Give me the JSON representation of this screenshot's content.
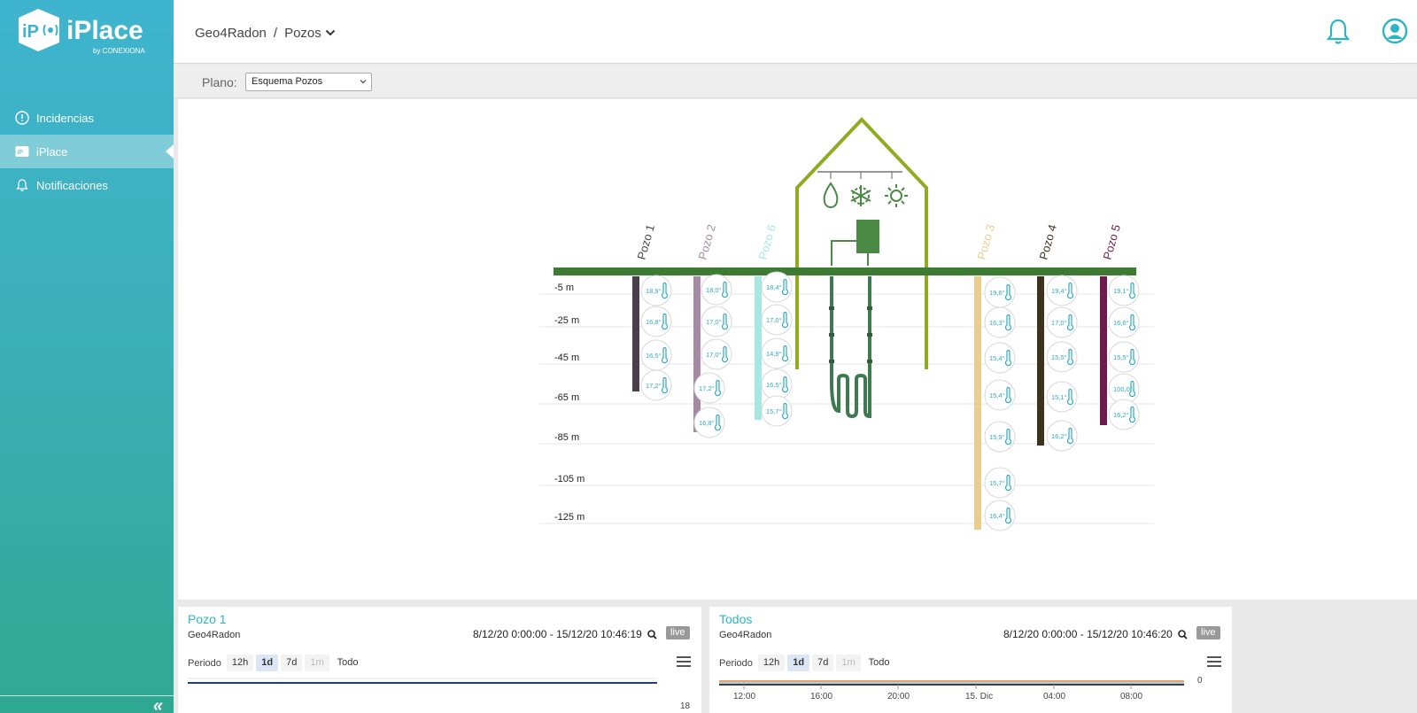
{
  "app": {
    "logo_text": "iPlace",
    "logo_byline": "by CONEXIONA"
  },
  "sidebar": {
    "items": [
      {
        "label": "Incidencias",
        "icon": "alert-circle-icon",
        "active": false
      },
      {
        "label": "iPlace",
        "icon": "iplace-icon",
        "active": true
      },
      {
        "label": "Notificaciones",
        "icon": "bell-icon",
        "active": false
      }
    ],
    "collapse_label": "«"
  },
  "header": {
    "breadcrumb": [
      "Geo4Radon",
      "Pozos"
    ],
    "separator": "/"
  },
  "plano": {
    "label": "Plano:",
    "selected": "Esquema Pozos"
  },
  "diagram": {
    "depth_labels": [
      "-5 m",
      "-25 m",
      "-45 m",
      "-65 m",
      "-85 m",
      "-105 m",
      "-125 m"
    ],
    "wells": [
      {
        "name": "Pozo 1",
        "color": "#4a3f48",
        "readings": [
          "18,9°",
          "16,8°",
          "16,5°",
          "17,2°"
        ]
      },
      {
        "name": "Pozo 2",
        "color": "#a68aa3",
        "readings": [
          "18,0°",
          "17,0°",
          "17,0°",
          "17,2°",
          "16,8°"
        ]
      },
      {
        "name": "Pozo 6",
        "color": "#a8e6e1",
        "readings": [
          "18,4°",
          "17,0°",
          "14,9°",
          "16,5°",
          "15,7°"
        ]
      },
      {
        "name": "Pozo 3",
        "color": "#e9cf8f",
        "readings": [
          "19,6°",
          "16,3°",
          "15,4°",
          "15,4°",
          "15,9°",
          "15,7°",
          "16,4°"
        ]
      },
      {
        "name": "Pozo 4",
        "color": "#3f321c",
        "readings": [
          "19,4°",
          "17,0°",
          "15,5°",
          "15,1°",
          "16,2°"
        ]
      },
      {
        "name": "Pozo 5",
        "color": "#6e1a4e",
        "readings": [
          "19,1°",
          "16,6°",
          "15,5°",
          "100,0°",
          "16,2°"
        ]
      }
    ],
    "ground_color": "#3d7a34",
    "house_color": "#8fab1f",
    "sensor_color": "#2fa9c3"
  },
  "cards": [
    {
      "title": "Pozo 1",
      "subtitle": "Geo4Radon",
      "range": "8/12/20 0:00:00 - 15/12/20 10:46:19",
      "live": "live",
      "periodo_label": "Periodo",
      "periods": [
        "12h",
        "1d",
        "7d",
        "1m",
        "Todo"
      ],
      "selected_period": "1d",
      "axis_value": "18"
    },
    {
      "title": "Todos",
      "subtitle": "Geo4Radon",
      "range": "8/12/20 0:00:00 - 15/12/20 10:46:20",
      "live": "live",
      "periodo_label": "Periodo",
      "periods": [
        "12h",
        "1d",
        "7d",
        "1m",
        "Todo"
      ],
      "selected_period": "1d",
      "axis_value": "0",
      "x_ticks": [
        "12:00",
        "16:00",
        "20:00",
        "15. Dic",
        "04:00",
        "08:00"
      ]
    }
  ]
}
